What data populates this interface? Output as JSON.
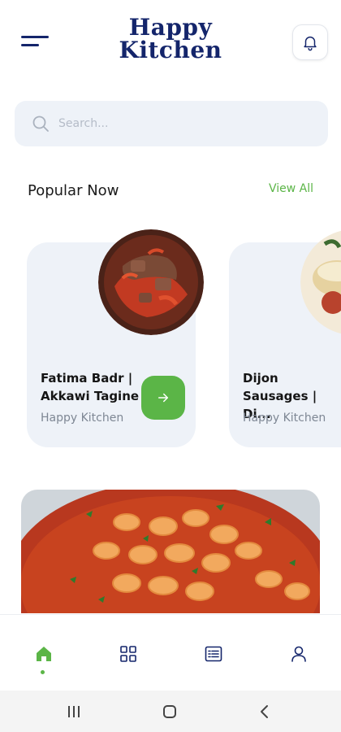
{
  "app": {
    "logo_line1": "Happy",
    "logo_line2": "Kitchen"
  },
  "search": {
    "placeholder": "Search..."
  },
  "popular": {
    "title": "Popular Now",
    "view_all": "View All",
    "cards": [
      {
        "title": "Fatima Badr | Akkawi Tagine",
        "author": "Happy Kitchen"
      },
      {
        "title": "Dijon Sausages | Di...",
        "author": "Happy Kitchen"
      }
    ]
  },
  "bottom_nav": {
    "items": [
      "home-icon",
      "grid-icon",
      "list-icon",
      "profile-icon"
    ],
    "active": "home-icon"
  },
  "colors": {
    "brand": "#14256b",
    "accent": "#5bb547",
    "card_bg": "#eef2f8"
  }
}
